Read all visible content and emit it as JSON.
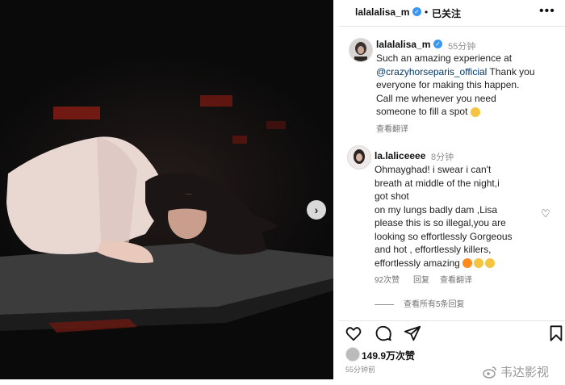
{
  "header": {
    "username": "lalalalisa_m",
    "separator": "•",
    "follow_status": "已关注",
    "more_icon": "more-horizontal-icon"
  },
  "caption": {
    "username": "lalalalisa_m",
    "time": "55分钟",
    "lines": [
      "Such an amazing experience at",
      "@crazyhorseparis_official",
      " Thank you",
      "everyone for making this happen.",
      "Call me whenever you need",
      "someone to fill a spot"
    ],
    "translate": "查看翻译"
  },
  "comment": {
    "username": "la.laliceeee",
    "time": "8分钟",
    "lines": [
      "Ohmayghad! i swear i can't",
      "breath at middle of the night,i",
      "got shot",
      "on my lungs badly dam ,Lisa",
      "please this is so illegal,you are",
      "looking so effortlessly Gorgeous",
      "and hot , effortlessly killers,",
      "effortlessly amazing"
    ],
    "likes": "92次赞",
    "reply": "回复",
    "translate": "查看翻译",
    "view_replies": "查看所有5条回复"
  },
  "actions": {
    "like_icon": "heart-icon",
    "comment_icon": "comment-icon",
    "share_icon": "send-icon",
    "save_icon": "bookmark-icon"
  },
  "likes": {
    "count": "149.9万次赞"
  },
  "post_time": "55分钟前",
  "watermark": "韦达影视",
  "photo": {
    "next_icon": "chevron-right-icon"
  },
  "colors": {
    "verified": "#3897f0",
    "link": "#00376b",
    "muted": "#737373"
  }
}
